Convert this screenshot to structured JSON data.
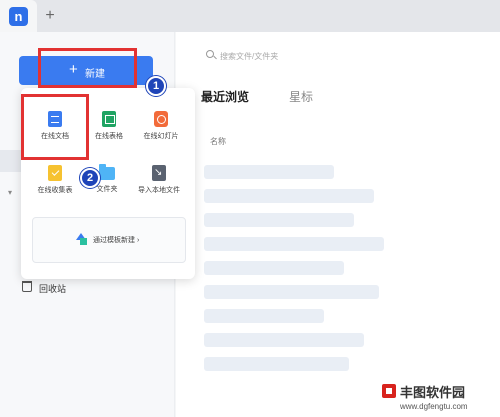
{
  "tabs": {
    "new_tab_symbol": "+",
    "logo_glyph": "n"
  },
  "sidebar": {
    "new_button": {
      "plus": "+",
      "label": "新建"
    },
    "recycle_bin": "回收站"
  },
  "main": {
    "search_placeholder": "搜索文件/文件夹",
    "tabs": {
      "recent": "最近浏览",
      "starred": "星标"
    },
    "column_name": "名称"
  },
  "popup": {
    "items": [
      {
        "label": "在线文档",
        "icon": "doc-icon",
        "color": "#3a7bf0"
      },
      {
        "label": "在线表格",
        "icon": "sheet-icon",
        "color": "#1fa463"
      },
      {
        "label": "在线幻灯片",
        "icon": "slide-icon",
        "color": "#f26b3a"
      },
      {
        "label": "在线收集表",
        "icon": "form-icon",
        "color": "#f6c230"
      },
      {
        "label": "文件夹",
        "icon": "folder-icon",
        "color": "#4fb4f6"
      },
      {
        "label": "导入本地文件",
        "icon": "import-icon",
        "color": "#5a6270"
      }
    ],
    "template": "通过模板新建 ›"
  },
  "annotations": {
    "step1": "1",
    "step2": "2",
    "highlight_color": "#e23232"
  },
  "watermark": {
    "name": "丰图软件园",
    "url": "www.dgfengtu.com"
  }
}
